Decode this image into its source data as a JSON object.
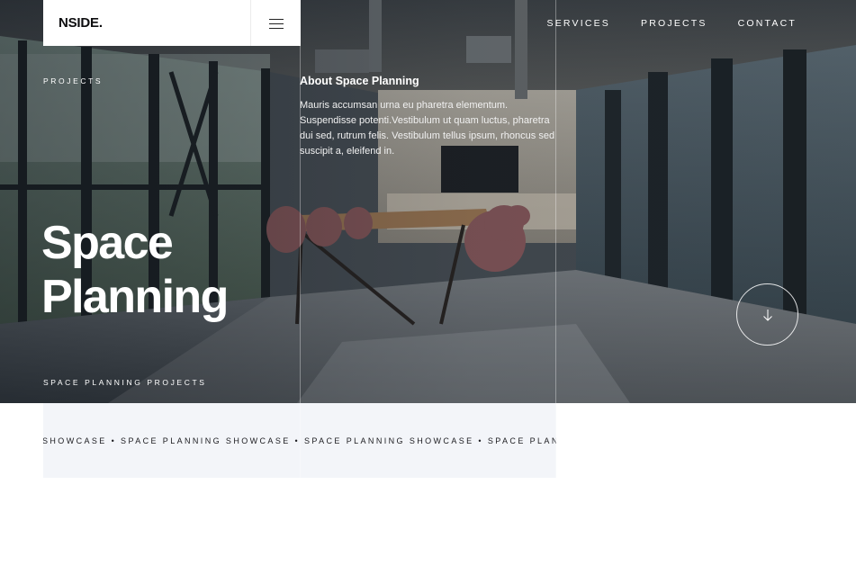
{
  "brand": {
    "logo": "NSIDE."
  },
  "header": {
    "menu_icon": "hamburger-icon",
    "nav": [
      {
        "label": "SERVICES"
      },
      {
        "label": "PROJECTS"
      },
      {
        "label": "CONTACT"
      }
    ]
  },
  "hero": {
    "eyebrow": "PROJECTS",
    "title_line1": "Space",
    "title_line2": "Planning",
    "subtitle": "SPACE PLANNING PROJECTS",
    "about_heading": "About Space Planning",
    "about_body": "Mauris accumsan urna eu pharetra elementum. Suspendisse potenti.Vestibulum ut quam luctus, pharetra dui sed, rutrum felis. Vestibulum tellus ipsum, rhoncus sed suscipit a, eleifend in.",
    "scroll_icon": "arrow-down-icon"
  },
  "marquee": {
    "text": "SHOWCASE • SPACE PLANNING SHOWCASE • SPACE PLANNING SHOWCASE • SPACE PLANNI"
  },
  "colors": {
    "strip_bg": "#f3f5f9",
    "text_dark": "#0e0e10",
    "white": "#ffffff"
  }
}
